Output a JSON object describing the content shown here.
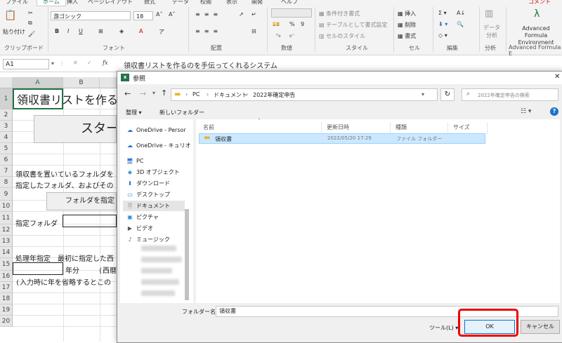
{
  "ribbon": {
    "tabs": [
      "ファイル",
      "ホーム",
      "挿入",
      "ページレイアウト",
      "数式",
      "データ",
      "校閲",
      "表示",
      "開発",
      "ヘルプ",
      "コメント"
    ],
    "active_tab": "ホーム",
    "clipboard": {
      "paste_label": "貼り付け",
      "group": "クリップボード"
    },
    "font": {
      "name": "游ゴシック",
      "size": "18",
      "group": "フォント"
    },
    "alignment_group": "配置",
    "number_group": "数値",
    "styles": {
      "conditional": "条件付き書式",
      "table": "テーブルとして書式設定",
      "cell_styles": "セルのスタイル",
      "group": "スタイル"
    },
    "cells": {
      "insert": "挿入",
      "delete": "削除",
      "format": "書式",
      "group": "セル"
    },
    "editing_group": "編集",
    "analysis": {
      "label": "データ分析",
      "group": "分析"
    },
    "afe": {
      "label": "Advanced Formula Environment",
      "group": "Advanced Formula E"
    }
  },
  "formula_bar": {
    "name_box": "A1",
    "fx": "fx",
    "content": "領収書リストを作るのを手伝ってくれるシステム"
  },
  "sheet": {
    "columns": [
      "A",
      "B"
    ],
    "rows": [
      "1",
      "2",
      "3",
      "4",
      "5",
      "6",
      "7",
      "8",
      "9",
      "10",
      "11",
      "12",
      "13",
      "14",
      "15",
      "16",
      "17",
      "18",
      "19",
      "20"
    ],
    "title_text": "領収書リストを作る",
    "start_button": "スター",
    "row7": "領収書を置いているフォルダを",
    "row8": "指定したフォルダ、およびその",
    "folder_button": "フォルダを指定",
    "row11": "指定フォルダ",
    "row14": "処理年指定　最初に指定した西",
    "row15_unit": "年分",
    "row15_note": "(西暦",
    "row16": "(入力時に年を省略するとこの"
  },
  "dialog": {
    "title": "参照",
    "path": [
      "PC",
      "ドキュメント",
      "2022年確定申告"
    ],
    "search_placeholder": "2022年確定申告の検索",
    "toolbar": {
      "organize": "整理",
      "new_folder": "新しいフォルダー"
    },
    "nav": [
      {
        "label": "OneDrive - Persor",
        "icon": "cloud-icon"
      },
      {
        "label": "OneDrive - キュリオ",
        "icon": "cloud-icon"
      },
      {
        "label": "PC",
        "icon": "computer-icon"
      },
      {
        "label": "3D オブジェクト",
        "icon": "cube-icon"
      },
      {
        "label": "ダウンロード",
        "icon": "download-icon"
      },
      {
        "label": "デスクトップ",
        "icon": "desktop-icon"
      },
      {
        "label": "ドキュメント",
        "icon": "document-icon"
      },
      {
        "label": "ピクチャ",
        "icon": "picture-icon"
      },
      {
        "label": "ビデオ",
        "icon": "video-icon"
      },
      {
        "label": "ミュージック",
        "icon": "music-icon"
      }
    ],
    "columns": {
      "name": "名前",
      "date": "更新日時",
      "type": "種類",
      "size": "サイズ"
    },
    "files": [
      {
        "name": "領収書",
        "date": "2022/05/20 17:29",
        "type": "ファイル フォルダー",
        "size": ""
      }
    ],
    "folder_name_label": "フォルダー名(N):",
    "folder_name_value": "領収書",
    "tools": "ツール(L)",
    "ok": "OK",
    "cancel": "キャンセル"
  }
}
